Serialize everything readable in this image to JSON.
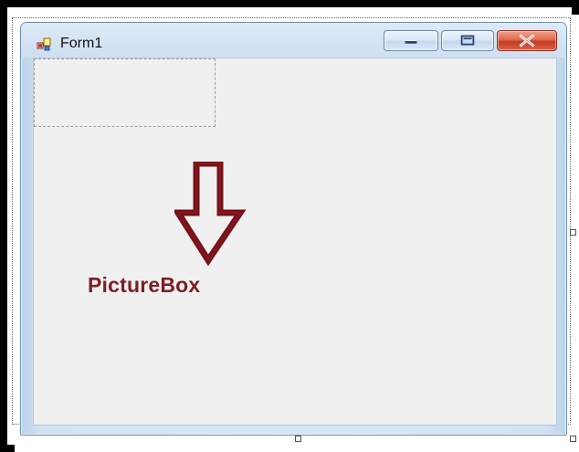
{
  "window": {
    "title": "Form1",
    "icons": {
      "app": "form-app-icon",
      "minimize": "minimize-icon",
      "maximize": "maximize-icon",
      "close": "close-icon"
    },
    "colors": {
      "frame": "#d7e6f5",
      "client": "#f0f0f0",
      "close_button": "#c63b21"
    }
  },
  "designer": {
    "selected_control": "PictureBox"
  },
  "annotation": {
    "label": "PictureBox",
    "arrow_icon": "down-arrow-icon",
    "color": "#7d1d24"
  }
}
